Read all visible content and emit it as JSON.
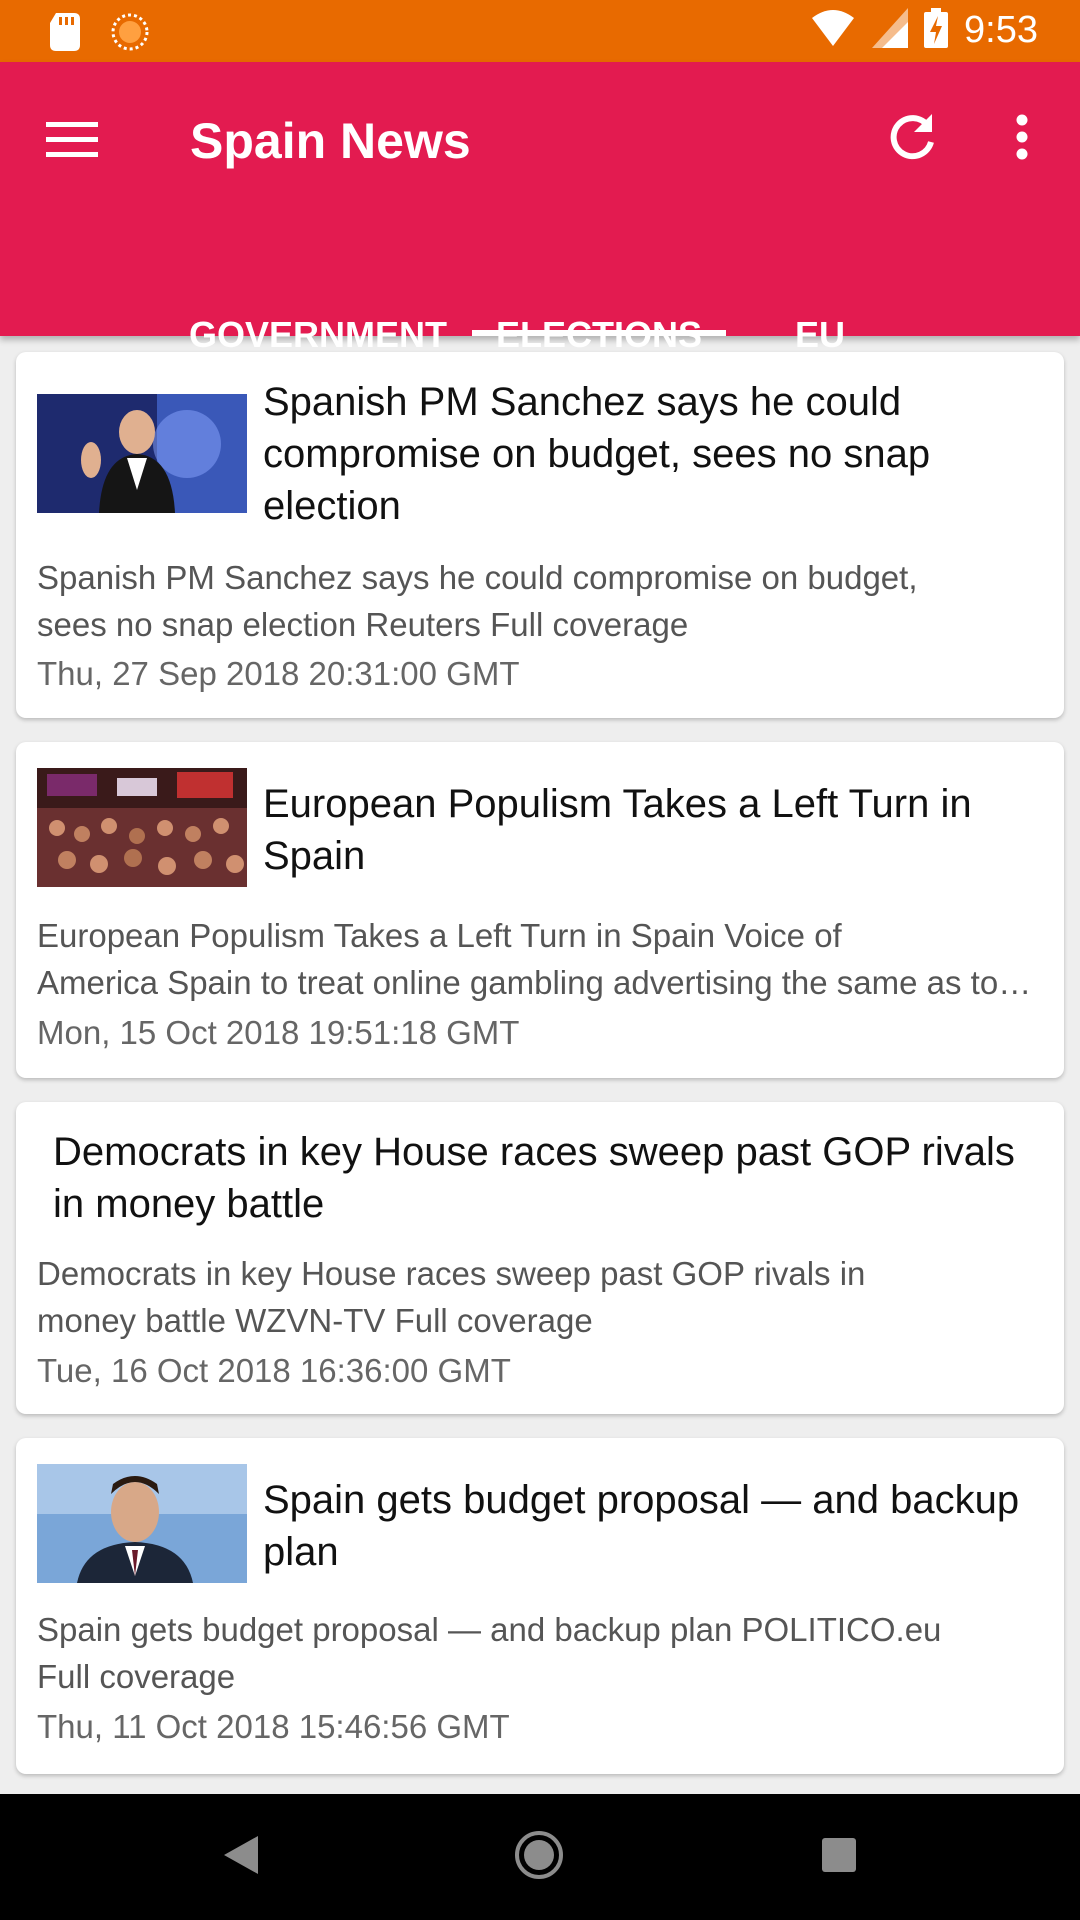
{
  "status": {
    "time": "9:53"
  },
  "app": {
    "title": "Spain News",
    "accent": "#e31b50",
    "status_bar_color": "#e86a00"
  },
  "icons": {
    "menu": "menu-icon",
    "refresh": "refresh-icon",
    "more": "more-vert-icon",
    "sd_card": "sd-card-icon",
    "sun": "sun-icon",
    "wifi": "wifi-icon",
    "signal": "signal-icon",
    "battery": "battery-charging-icon",
    "back": "back-icon",
    "home": "home-icon",
    "recents": "recents-icon"
  },
  "tabs": [
    {
      "label": "GOVERNMENT"
    },
    {
      "label": "ELECTIONS",
      "selected": true
    },
    {
      "label": "EU"
    }
  ],
  "articles": [
    {
      "title": "Spanish PM Sanchez says he could compromise on budget, sees no snap election",
      "desc_1": "Spanish PM Sanchez says he could compromise on budget,",
      "desc_2": "sees no snap election  Reuters  Full coverage",
      "date": "Thu, 27 Sep 2018 20:31:00 GMT",
      "has_image": true
    },
    {
      "title": "European Populism Takes a Left Turn in Spain",
      "desc_1": "European Populism Takes a Left Turn in Spain  Voice of",
      "desc_2": "America  Spain to treat online gambling advertising the same as tobacco",
      "date": "Mon, 15 Oct 2018 19:51:18 GMT",
      "has_image": true
    },
    {
      "title": "Democrats in key House races sweep past GOP rivals in money battle",
      "desc_1": "Democrats in key House races sweep past GOP rivals in",
      "desc_2": "money battle  WZVN-TV  Full coverage",
      "date": "Tue, 16 Oct 2018 16:36:00 GMT",
      "has_image": false
    },
    {
      "title": "Spain gets budget proposal — and backup plan",
      "desc_1": "Spain gets budget proposal — and backup plan  POLITICO.eu",
      "desc_2": "Full coverage",
      "date": "Thu, 11 Oct 2018 15:46:56 GMT",
      "has_image": true
    }
  ]
}
